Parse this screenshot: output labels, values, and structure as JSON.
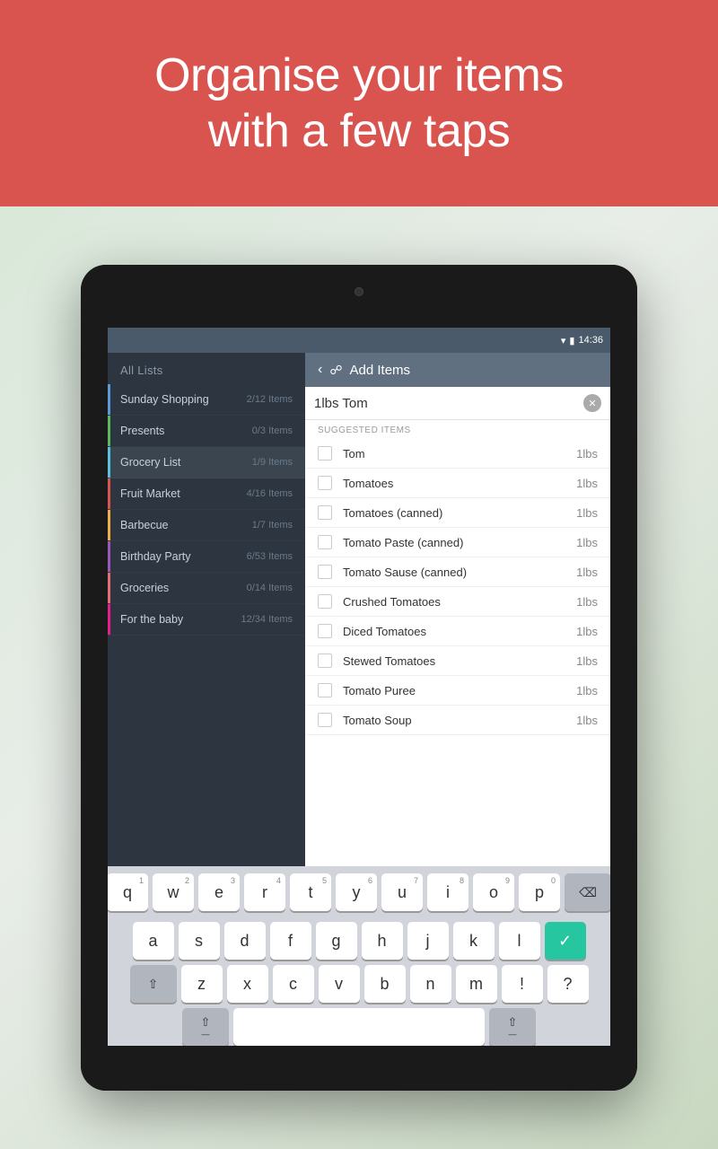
{
  "header": {
    "title_line1": "Organise your items",
    "title_line2": "with a few taps",
    "bg_color": "#d9534f"
  },
  "status_bar": {
    "time": "14:36"
  },
  "sidebar": {
    "header_label": "All Lists",
    "items": [
      {
        "name": "Sunday Shopping",
        "count": "2/12 Items",
        "bar": "bar-blue",
        "sync": true
      },
      {
        "name": "Presents",
        "count": "0/3 Items",
        "bar": "bar-green",
        "sync": false
      },
      {
        "name": "Grocery List",
        "count": "1/9 Items",
        "bar": "bar-teal",
        "sync": true,
        "active": true
      },
      {
        "name": "Fruit Market",
        "count": "4/16 Items",
        "bar": "bar-red",
        "sync": true
      },
      {
        "name": "Barbecue",
        "count": "1/7 Items",
        "bar": "bar-yellow",
        "sync": false
      },
      {
        "name": "Birthday Party",
        "count": "6/53 Items",
        "bar": "bar-purple",
        "sync": false
      },
      {
        "name": "Groceries",
        "count": "0/14 Items",
        "bar": "bar-coral",
        "sync": false
      },
      {
        "name": "For the baby",
        "count": "12/34 Items",
        "bar": "bar-pink",
        "sync": false
      }
    ]
  },
  "panel": {
    "title": "Add Items",
    "search_value": "1lbs Tom",
    "suggested_label": "SUGGESTED ITEMS",
    "items": [
      {
        "name": "Tom",
        "qty": "1lbs"
      },
      {
        "name": "Tomatoes",
        "qty": "1lbs"
      },
      {
        "name": "Tomatoes (canned)",
        "qty": "1lbs"
      },
      {
        "name": "Tomato Paste (canned)",
        "qty": "1lbs"
      },
      {
        "name": "Tomato Sause (canned)",
        "qty": "1lbs"
      },
      {
        "name": "Crushed Tomatoes",
        "qty": "1lbs"
      },
      {
        "name": "Diced Tomatoes",
        "qty": "1lbs"
      },
      {
        "name": "Stewed Tomatoes",
        "qty": "1lbs"
      },
      {
        "name": "Tomato Puree",
        "qty": "1lbs"
      },
      {
        "name": "Tomato Soup",
        "qty": "1lbs"
      }
    ]
  },
  "keyboard": {
    "rows": [
      [
        "q",
        "w",
        "e",
        "r",
        "t",
        "y",
        "u",
        "i",
        "o",
        "p"
      ],
      [
        "a",
        "s",
        "d",
        "f",
        "g",
        "h",
        "j",
        "k",
        "l"
      ],
      [
        "z",
        "x",
        "c",
        "v",
        "b",
        "n",
        "m",
        "!",
        "?"
      ]
    ],
    "nums": [
      "1",
      "2",
      "3",
      "4",
      "5",
      "6",
      "7",
      "8",
      "9",
      "0"
    ]
  }
}
